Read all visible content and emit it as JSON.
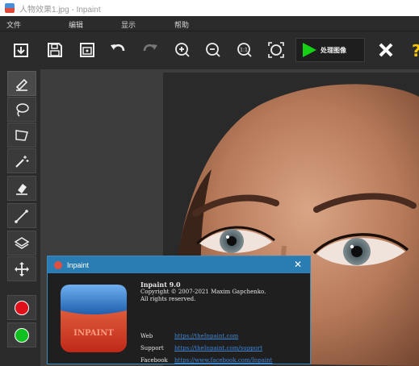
{
  "window": {
    "title": "人物效果1.jpg - Inpaint"
  },
  "menu": {
    "items": [
      "文件",
      "编辑",
      "显示",
      "帮助"
    ]
  },
  "toolbar": {
    "icons": [
      "open-icon",
      "save-icon",
      "save-as-icon",
      "undo-icon",
      "redo-icon",
      "zoom-in-icon",
      "zoom-out-icon",
      "actual-size-icon",
      "fit-window-icon"
    ],
    "process_label": "处理图像",
    "colors": {
      "background": "#2b2b2b",
      "play_green": "#16d016",
      "accent_yellow": "#f5c400"
    }
  },
  "tools": {
    "icons": [
      "marker-icon",
      "lasso-icon",
      "polygon-lasso-icon",
      "magic-wand-icon",
      "eraser-icon",
      "line-icon",
      "layers-icon",
      "move-icon"
    ],
    "colors": {
      "red": "#e0101a",
      "green": "#10c020"
    }
  },
  "dialog": {
    "title": "Inpaint",
    "close": "✕",
    "logo_text": "INPAINT",
    "product": "Inpaint 9.0",
    "copyright": "Copyright © 2007-2021 Maxim Gapchenko.",
    "rights": "All rights reserved.",
    "links": [
      {
        "label": "Web",
        "url": "https://theInpaint.com"
      },
      {
        "label": "Support",
        "url": "https://theInpaint.com/support"
      },
      {
        "label": "Facebook",
        "url": "https://www.facebook.com/Inpaint"
      }
    ]
  }
}
